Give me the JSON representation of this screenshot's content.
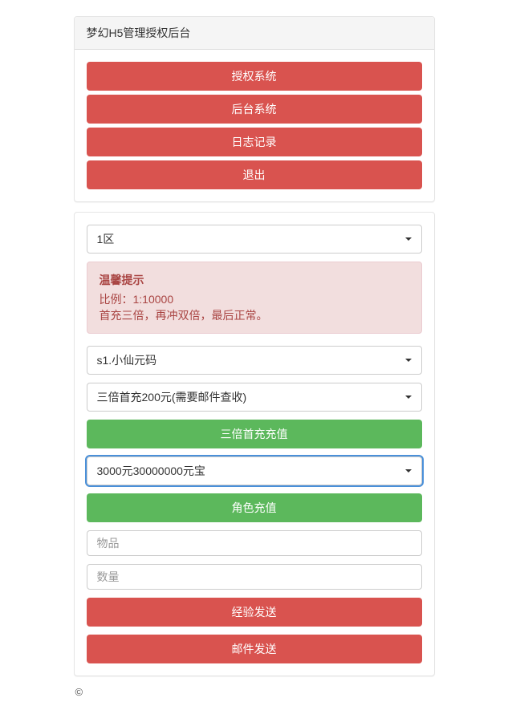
{
  "header": {
    "title": "梦幻H5管理授权后台"
  },
  "nav": {
    "auth_system": "授权系统",
    "backend_system": "后台系统",
    "log_record": "日志记录",
    "logout": "退出"
  },
  "zone_select": {
    "selected": "1区"
  },
  "alert": {
    "title": "温馨提示",
    "line1": "比例：1:10000",
    "line2": "首充三倍，再冲双倍，最后正常。"
  },
  "player_select": {
    "selected": "s1.小仙元码"
  },
  "first_recharge_select": {
    "selected": "三倍首充200元(需要邮件查收)"
  },
  "triple_recharge_button": "三倍首充充值",
  "amount_select": {
    "selected": "3000元30000000元宝"
  },
  "role_recharge_button": "角色充值",
  "item_input": {
    "placeholder": "物品",
    "value": ""
  },
  "quantity_input": {
    "placeholder": "数量",
    "value": ""
  },
  "exp_send_button": "经验发送",
  "mail_send_button": "邮件发送",
  "footer": "©"
}
